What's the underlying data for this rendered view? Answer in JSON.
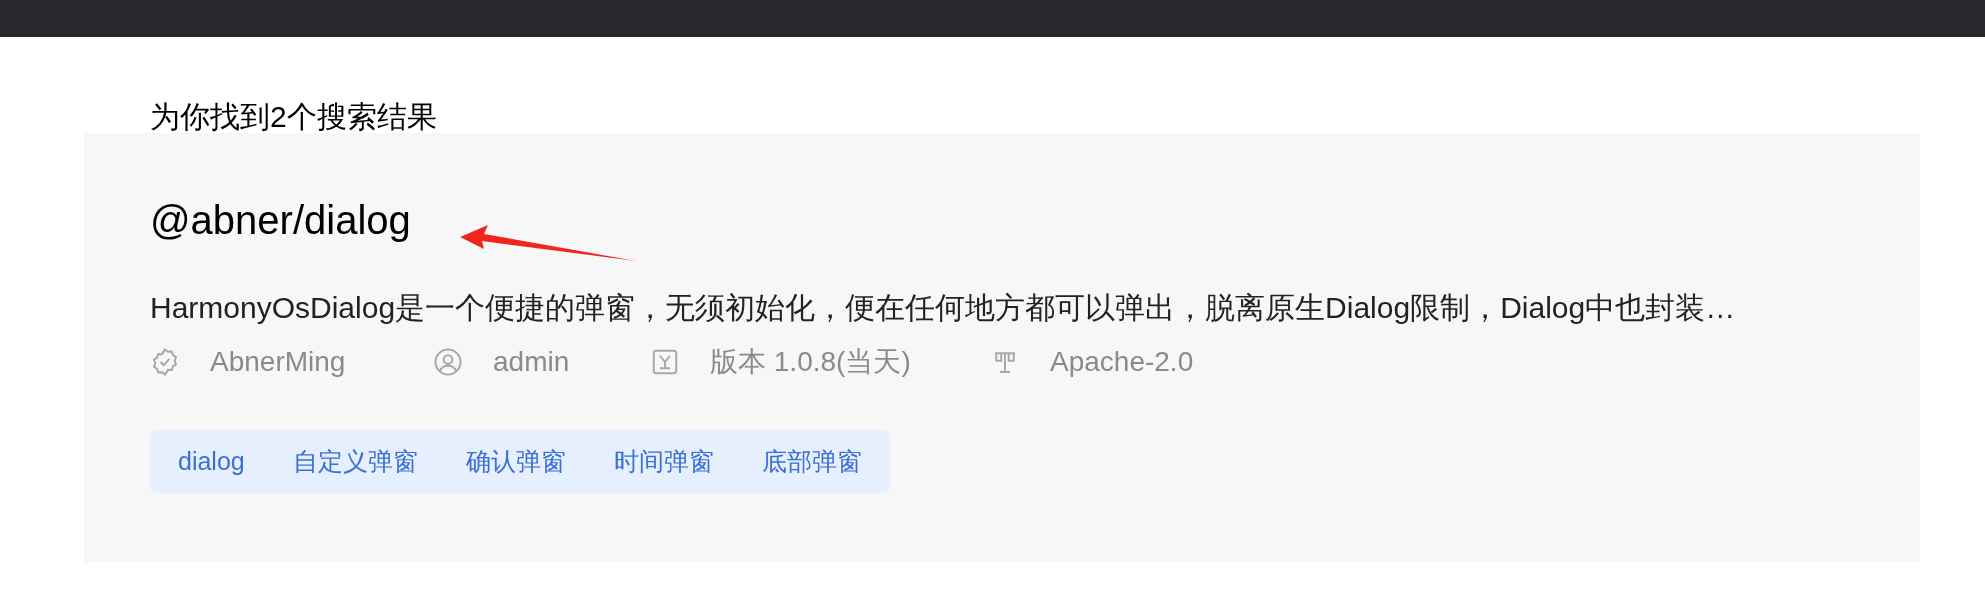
{
  "results_heading": "为你找到2个搜索结果",
  "results": [
    {
      "name": "@abner/dialog",
      "description": "HarmonyOsDialog是一个便捷的弹窗，无须初始化，便在任何地方都可以弹出，脱离原生Dialog限制，Dialog中也封装…",
      "meta": [
        {
          "kind": "verified",
          "text": "AbnerMing"
        },
        {
          "kind": "user",
          "text": "admin"
        },
        {
          "kind": "version",
          "text": "版本 1.0.8(当天)"
        },
        {
          "kind": "license",
          "text": "Apache-2.0"
        }
      ],
      "tags": [
        "dialog",
        "自定义弹窗",
        "确认弹窗",
        "时间弹窗",
        "底部弹窗"
      ]
    }
  ]
}
